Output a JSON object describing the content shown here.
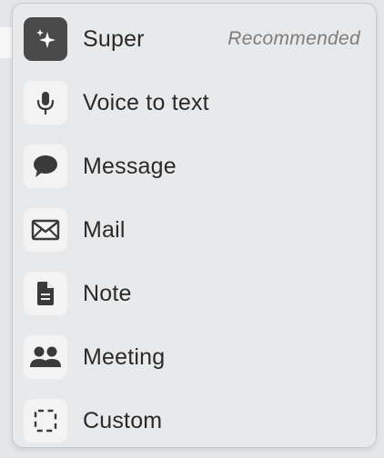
{
  "menu": {
    "items": [
      {
        "label": "Super",
        "badge": "Recommended",
        "icon": "sparkles-icon"
      },
      {
        "label": "Voice to text",
        "icon": "microphone-icon"
      },
      {
        "label": "Message",
        "icon": "chat-bubble-icon"
      },
      {
        "label": "Mail",
        "icon": "envelope-icon"
      },
      {
        "label": "Note",
        "icon": "document-icon"
      },
      {
        "label": "Meeting",
        "icon": "people-icon"
      },
      {
        "label": "Custom",
        "icon": "dashed-square-icon"
      }
    ]
  },
  "colors": {
    "menu_background": "#e8e9ea",
    "icon_tile": "#f3f3f4",
    "icon_tile_active": "#4a4a4a",
    "text": "#2a2a2a",
    "badge_text": "#7d7d7d"
  }
}
